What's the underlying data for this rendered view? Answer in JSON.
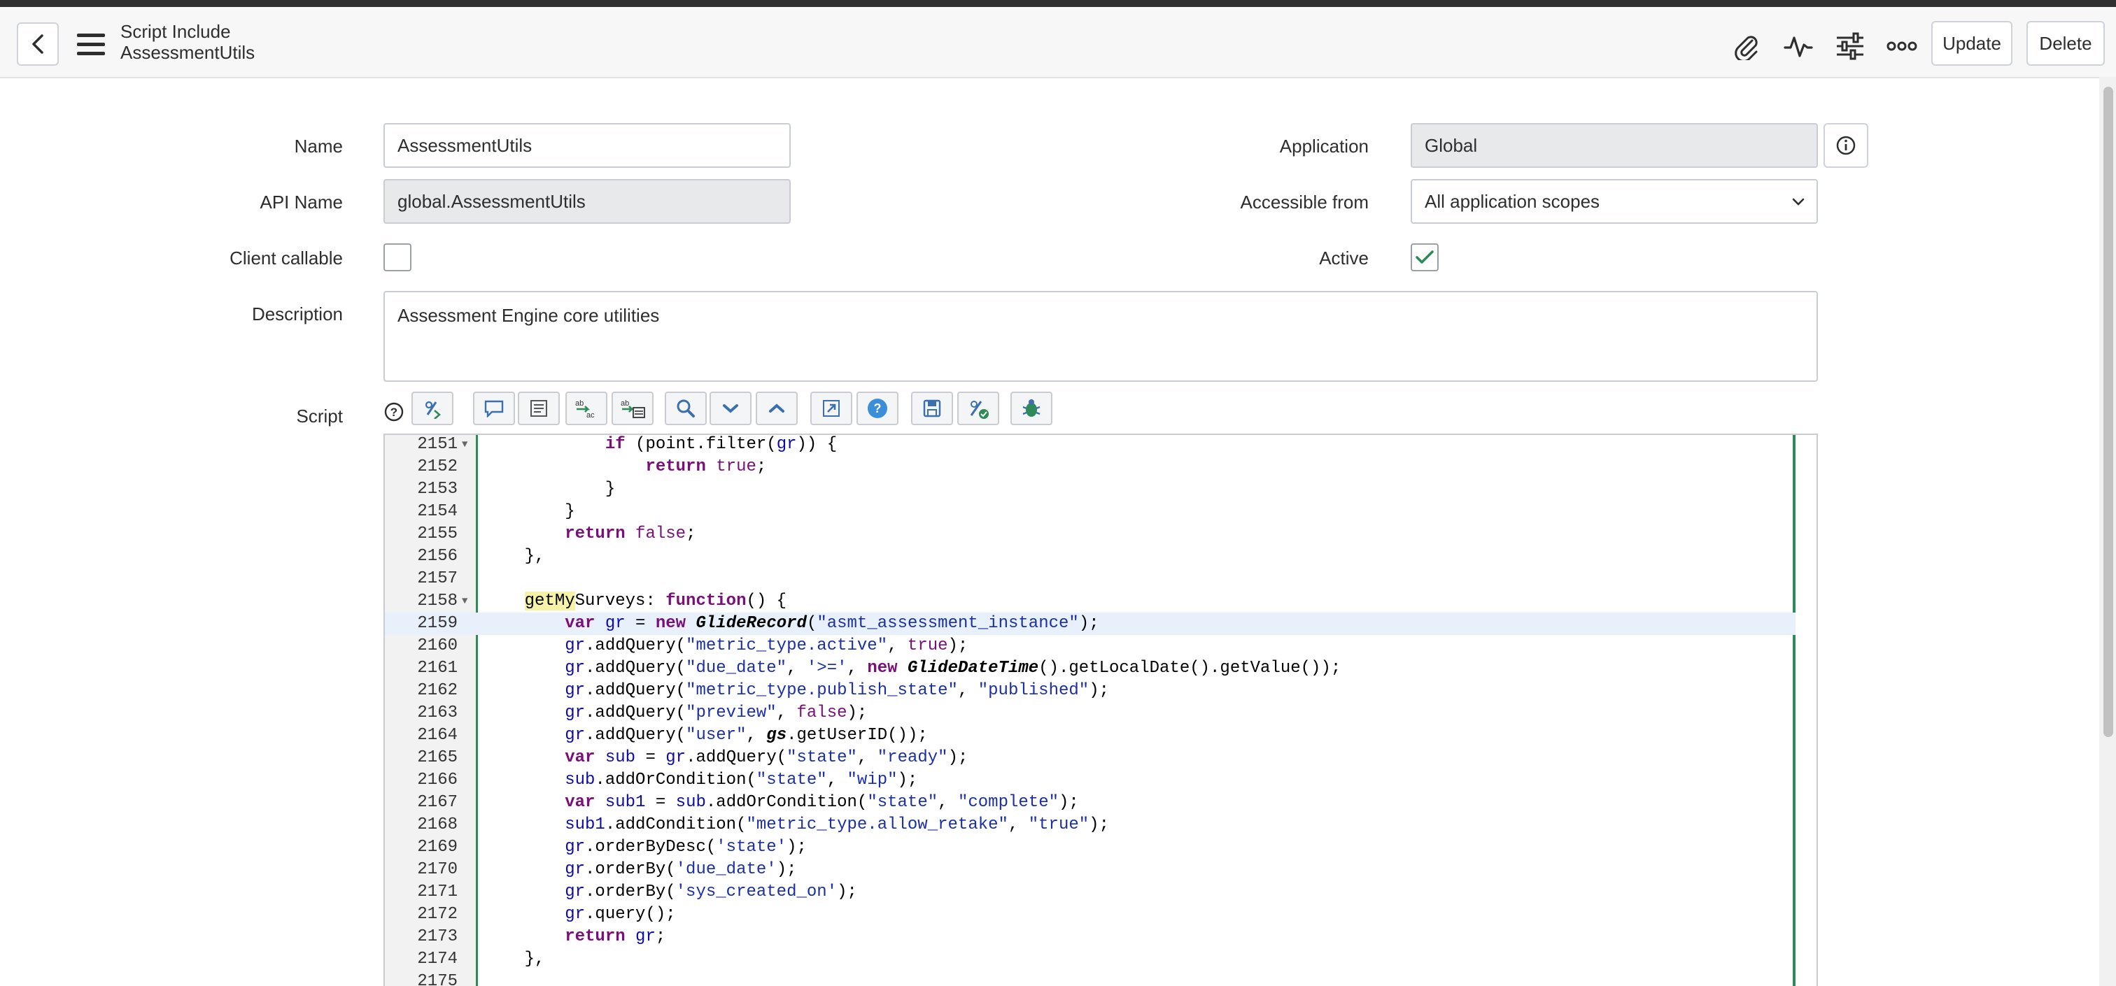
{
  "header": {
    "title_line1": "Script Include",
    "title_line2": "AssessmentUtils",
    "icons": [
      "attachment-icon",
      "activity-icon",
      "settings-sliders-icon",
      "more-icon"
    ],
    "update_label": "Update",
    "delete_label": "Delete"
  },
  "form": {
    "name_label": "Name",
    "name_value": "AssessmentUtils",
    "api_name_label": "API Name",
    "api_name_value": "global.AssessmentUtils",
    "client_callable_label": "Client callable",
    "client_callable_checked": false,
    "description_label": "Description",
    "description_value": "Assessment Engine core utilities",
    "application_label": "Application",
    "application_value": "Global",
    "accessible_from_label": "Accessible from",
    "accessible_from_value": "All application scopes",
    "active_label": "Active",
    "active_checked": true,
    "script_label": "Script"
  },
  "toolbar": {
    "help_icon": "help-circle-icon",
    "buttons": [
      "format-code-icon",
      "comment-icon",
      "toggle-comment-icon",
      "replace-icon",
      "replace-all-icon",
      "search-icon",
      "find-next-icon",
      "find-previous-icon",
      "fullscreen-icon",
      "help-icon",
      "save-icon",
      "script-debug-icon",
      "debugger-icon"
    ]
  },
  "editor": {
    "lines": [
      {
        "n": "2151",
        "fold": true,
        "code": "            if (point.filter(gr)) {"
      },
      {
        "n": "2152",
        "code": "                return true;"
      },
      {
        "n": "2153",
        "code": "            }"
      },
      {
        "n": "2154",
        "code": "        }"
      },
      {
        "n": "2155",
        "code": "        return false;"
      },
      {
        "n": "2156",
        "code": "    },"
      },
      {
        "n": "2157",
        "code": ""
      },
      {
        "n": "2158",
        "fold": true,
        "code": "    getMySurveys: function() {"
      },
      {
        "n": "2159",
        "code": "        var gr = new GlideRecord(\"asmt_assessment_instance\");"
      },
      {
        "n": "2160",
        "code": "        gr.addQuery(\"metric_type.active\", true);"
      },
      {
        "n": "2161",
        "code": "        gr.addQuery(\"due_date\", '>=', new GlideDateTime().getLocalDate().getValue());"
      },
      {
        "n": "2162",
        "code": "        gr.addQuery(\"metric_type.publish_state\", \"published\");"
      },
      {
        "n": "2163",
        "code": "        gr.addQuery(\"preview\", false);"
      },
      {
        "n": "2164",
        "code": "        gr.addQuery(\"user\", gs.getUserID());"
      },
      {
        "n": "2165",
        "code": "        var sub = gr.addQuery(\"state\", \"ready\");"
      },
      {
        "n": "2166",
        "code": "        sub.addOrCondition(\"state\", \"wip\");"
      },
      {
        "n": "2167",
        "code": "        var sub1 = sub.addOrCondition(\"state\", \"complete\");"
      },
      {
        "n": "2168",
        "code": "        sub1.addCondition(\"metric_type.allow_retake\", \"true\");"
      },
      {
        "n": "2169",
        "code": "        gr.orderByDesc('state');"
      },
      {
        "n": "2170",
        "code": "        gr.orderBy('due_date');"
      },
      {
        "n": "2171",
        "code": "        gr.orderBy('sys_created_on');"
      },
      {
        "n": "2172",
        "code": "        gr.query();"
      },
      {
        "n": "2173",
        "code": "        return gr;"
      },
      {
        "n": "2174",
        "code": "    },"
      },
      {
        "n": "2175",
        "code": ""
      }
    ],
    "active_line": "2159",
    "highlight_word": "getMy"
  },
  "colors": {
    "accent_green": "#2e8b57",
    "keyword": "#7a0f7a",
    "string": "#1a2fa8",
    "active_line_bg": "#e8f1fb"
  }
}
